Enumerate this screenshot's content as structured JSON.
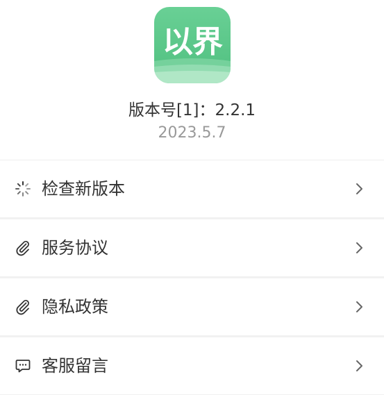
{
  "app": {
    "logo_text": "以界",
    "version_label": "版本号[1]：2.2.1",
    "date": "2023.5.7"
  },
  "colors": {
    "brand_green": "#5ec98b",
    "text_primary": "#333333",
    "text_secondary": "#999999",
    "divider": "#f1f1f1"
  },
  "menu": {
    "items": [
      {
        "label": "检查新版本",
        "icon": "loading-spinner-icon"
      },
      {
        "label": "服务协议",
        "icon": "paperclip-icon"
      },
      {
        "label": "隐私政策",
        "icon": "paperclip-icon"
      },
      {
        "label": "客服留言",
        "icon": "chat-bubble-icon"
      }
    ]
  }
}
